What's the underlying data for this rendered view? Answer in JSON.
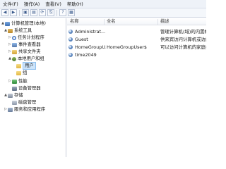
{
  "menubar": {
    "items": [
      "文件(F)",
      "操作(A)",
      "查看(V)",
      "帮助(H)"
    ]
  },
  "toolbar": {
    "buttons": [
      {
        "name": "back-icon",
        "glyph": "◀"
      },
      {
        "name": "forward-icon",
        "glyph": "▶"
      },
      {
        "name": "up-icon",
        "glyph": "▣"
      },
      {
        "name": "show-tree-icon",
        "glyph": "▤"
      },
      {
        "name": "refresh-icon",
        "glyph": "⟳"
      },
      {
        "name": "export-icon",
        "glyph": "⎘"
      },
      {
        "name": "help-icon",
        "glyph": "?"
      },
      {
        "name": "properties-icon",
        "glyph": "▦"
      }
    ]
  },
  "tree": {
    "items": [
      {
        "label": "计算机管理(本地)",
        "icon": "computer-icon",
        "expander": "▲"
      },
      {
        "label": "系统工具",
        "icon": "tools-icon",
        "expander": "▲"
      },
      {
        "label": "任务计划程序",
        "icon": "clock-icon",
        "expander": "▷"
      },
      {
        "label": "事件查看器",
        "icon": "event-viewer-icon",
        "expander": "▷"
      },
      {
        "label": "共享文件夹",
        "icon": "shared-folder-icon",
        "expander": "▷"
      },
      {
        "label": "本地用户和组",
        "icon": "users-icon",
        "expander": "▲"
      },
      {
        "label": "用户",
        "icon": "folder-icon",
        "expander": "",
        "selected": true
      },
      {
        "label": "组",
        "icon": "folder-icon",
        "expander": ""
      },
      {
        "label": "性能",
        "icon": "performance-icon",
        "expander": "▷"
      },
      {
        "label": "设备管理器",
        "icon": "device-manager-icon",
        "expander": ""
      },
      {
        "label": "存储",
        "icon": "storage-icon",
        "expander": "▲"
      },
      {
        "label": "磁盘管理",
        "icon": "disk-icon",
        "expander": ""
      },
      {
        "label": "服务和应用程序",
        "icon": "services-icon",
        "expander": "▷"
      }
    ]
  },
  "table": {
    "columns": {
      "name": "名称",
      "fullname": "全名",
      "description": "描述"
    },
    "rows": [
      {
        "name": "Administrat...",
        "fullname": "",
        "description": "管理计算机(域)的内置帐"
      },
      {
        "name": "Guest",
        "fullname": "",
        "description": "供来宾访问计算机或访问"
      },
      {
        "name": "HomeGroupU...",
        "fullname": "HomeGroupUser$",
        "description": "可以访问计算机的家庭组"
      },
      {
        "name": "time2049",
        "fullname": "",
        "description": ""
      }
    ]
  }
}
